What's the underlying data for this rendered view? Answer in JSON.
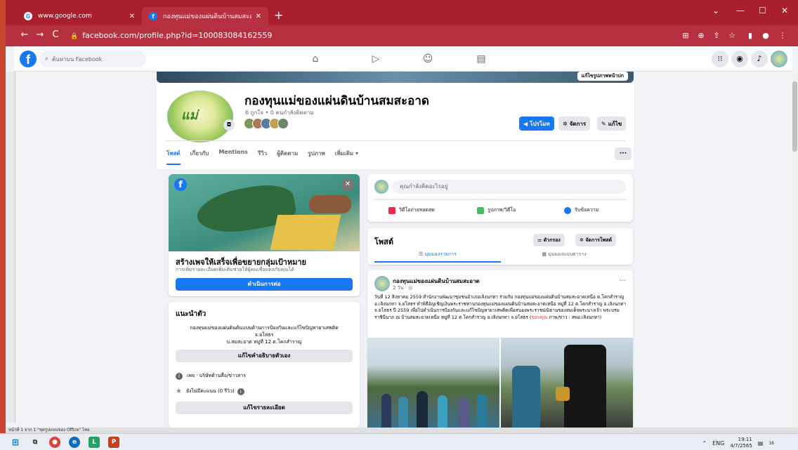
{
  "browser": {
    "tabs": [
      {
        "title": "www.google.com",
        "icon": "google-icon"
      },
      {
        "title": "กองทุนแม่ของแผ่นดินบ้านสมสะอาด | F",
        "icon": "facebook-icon"
      }
    ],
    "new_tab": "+",
    "url": "facebook.com/profile.php?id=100083084162559",
    "window_controls": [
      "⌄",
      "—",
      "☐",
      "✕"
    ]
  },
  "fb_header": {
    "search_placeholder": "ค้นหาบน Facebook",
    "brand_color": "#1877f2"
  },
  "profile": {
    "cover_button": "แก้ไขรูปภาพหน้าปก",
    "logo_text": "แม่",
    "name": "กองทุนแม่ของแผ่นดินบ้านสมสะอาด",
    "stats": "6 ถูกใจ • 0 คนกำลังติดตาม",
    "buttons": {
      "promote": "โปรโมท",
      "manage": "จัดการ",
      "edit": "แก้ไข"
    },
    "tabs": [
      "โพสต์",
      "เกี่ยวกับ",
      "Mentions",
      "รีวิว",
      "ผู้ติดตาม",
      "รูปภาพ",
      "เพิ่มเติม ▾"
    ],
    "tabs_more": "···"
  },
  "ad_card": {
    "title": "สร้างเพจให้เสร็จเพื่อขยายกลุ่มเป้าหมาย",
    "subtitle": "การเพิ่มรายละเอียดเพิ่มเติมช่วยให้ผู้คนเชื่อมต่อกับคุณได้",
    "button": "ดำเนินการต่อ"
  },
  "intro": {
    "title": "แนะนำตัว",
    "description_lines": [
      "กองทุนแม่ของแผ่นดินต้นแบบด้านการป้องกันและแก้ไขปัญหายาเสพติด",
      "จ.ยโสธร",
      "บ.สมสะอาด หมู่ที่ 12 ต.โคกสำราญ"
    ],
    "edit_bio_button": "แก้ไขคำอธิบายตัวเอง",
    "category": "เพจ · บริษัทด้านสื่อ/ข่าวสาร",
    "rating": "ยังไม่มีคะแนน (0 รีวิว)",
    "edit_details_button": "แก้ไขรายละเอียด"
  },
  "composer": {
    "placeholder": "คุณกำลังคิดอะไรอยู่",
    "actions": [
      "วิดีโอถ่ายทอดสด",
      "รูปภาพ/วิดีโอ",
      "รับข้อความ"
    ]
  },
  "posts_bar": {
    "title": "โพสต์",
    "filter": "ตัวกรอง",
    "manage": "จัดการโพสต์",
    "view_list": "มุมมองรายการ",
    "view_grid": "มุมมองแบบตาราง"
  },
  "post": {
    "author": "กองทุนแม่ของแผ่นดินบ้านสมสะอาด",
    "time": "2 วัน · ◎",
    "more": "···",
    "body_part1": "วันที่ 12 สิงหาคม 2559 สำนักงานพัฒนาชุมชนอำเภอเลิงนกทา ร่วมกับ กองทุนแม่ของแผ่นดินบ้านสมสะอาดเหนือ ต.โคกสำราญ อ.เลิงนกทา จ.ยโสธร ทำพิธีอัญเชิญเงินพระราชทานกองทุนแม่ของแผ่นดินบ้านสมสะอาดเหนือ หมู่ที่ 12 ต.โคกสำราญ อ.เลิงนกทา จ.ยโสธร ปี 2559 เพื่อไปดำเนินการป้องกันและแก้ไขปัญหายาเสพติดเพื่อสนองพระราชปณิธานของสมเด็จพระนางเจ้า พระบรมราชินีนาถ ณ บ้านสมสะอาดเหนือ หมู่ที่ 12 ต.โคกสำราญ อ.เลิงนกทา จ.ยโสธร (",
    "body_link": "ขอบคุณ",
    "body_part2": " ภาพ/ข่าว : สพอ.เลิงนกทา)"
  },
  "status": {
    "left_text": "หน้าที่ 1 จาก 1    \"ชุดรูปแบบของ Office\"    ไทย"
  },
  "taskbar": {
    "lang": "ENG",
    "time": "19:11",
    "date": "4/7/2565",
    "notif": "16"
  }
}
